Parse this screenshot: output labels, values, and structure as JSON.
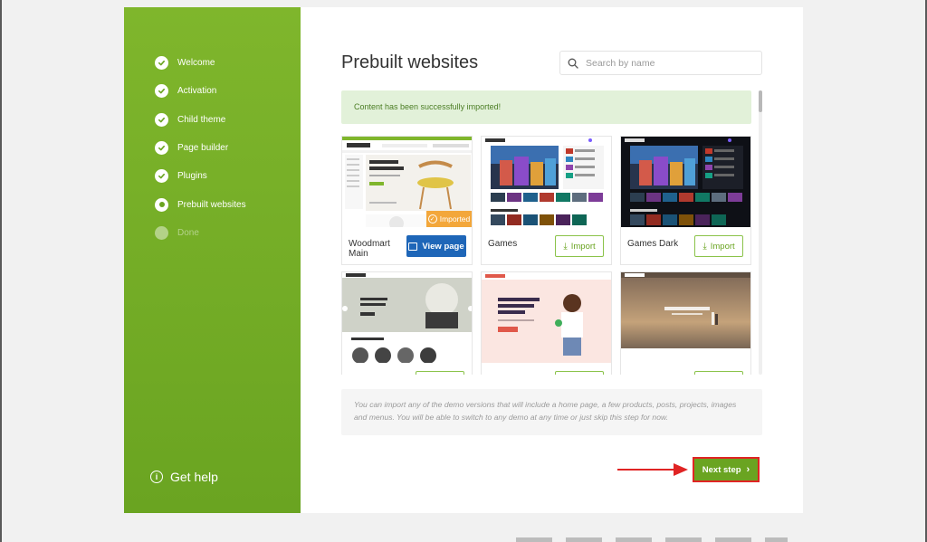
{
  "colors": {
    "accent_green": "#6aa421",
    "sidebar_green": "#7fb62c",
    "view_blue": "#1e66b8",
    "imported_orange": "#f3a73b",
    "highlight_red": "#e02424"
  },
  "sidebar": {
    "steps": [
      {
        "label": "Welcome",
        "state": "done",
        "icon": "check-icon"
      },
      {
        "label": "Activation",
        "state": "done",
        "icon": "check-icon"
      },
      {
        "label": "Child theme",
        "state": "done",
        "icon": "check-icon"
      },
      {
        "label": "Page builder",
        "state": "done",
        "icon": "check-icon"
      },
      {
        "label": "Plugins",
        "state": "done",
        "icon": "check-icon"
      },
      {
        "label": "Prebuilt websites",
        "state": "current",
        "icon": "dot-icon"
      },
      {
        "label": "Done",
        "state": "pending",
        "icon": "circle-icon"
      }
    ],
    "get_help": "Get help"
  },
  "main": {
    "title": "Prebuilt websites",
    "search_placeholder": "Search by name",
    "notice": "Content has been successfully imported!",
    "demos": [
      {
        "name": "Woodmart Main",
        "action": "View page",
        "badge": "Imported"
      },
      {
        "name": "Games",
        "action": "Import"
      },
      {
        "name": "Games Dark",
        "action": "Import"
      }
    ],
    "info": "You can import any of the demo versions that will include a home page, a few products, posts, projects, images and menus. You will be able to switch to any demo at any time or just skip this step for now.",
    "next_step": "Next step"
  }
}
